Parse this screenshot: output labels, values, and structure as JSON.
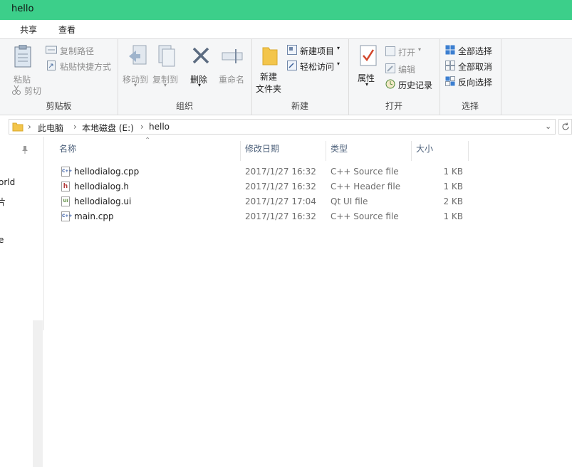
{
  "window": {
    "title": "hello"
  },
  "tabs": [
    {
      "label": "共享"
    },
    {
      "label": "查看"
    }
  ],
  "ribbon": {
    "clipboard": {
      "label": "剪贴板",
      "paste": "粘贴",
      "copy_path": "复制路径",
      "paste_shortcut": "粘贴快捷方式",
      "cut": "剪切"
    },
    "organize": {
      "label": "组织",
      "move_to": "移动到",
      "copy_to": "复制到",
      "delete": "删除",
      "rename": "重命名"
    },
    "new": {
      "label": "新建",
      "new_item": "新建项目",
      "easy_access": "轻松访问",
      "new_folder_line1": "新建",
      "new_folder_line2": "文件夹"
    },
    "open": {
      "label": "打开",
      "properties": "属性",
      "open": "打开",
      "edit": "编辑",
      "history": "历史记录"
    },
    "select": {
      "label": "选择",
      "select_all": "全部选择",
      "select_none": "全部取消",
      "invert": "反向选择"
    }
  },
  "address": {
    "crumbs": [
      {
        "label": "此电脑"
      },
      {
        "label": "本地磁盘 (E:)"
      },
      {
        "label": "hello"
      }
    ]
  },
  "nav": {
    "items": [
      {
        "label": "orld"
      },
      {
        "label": "片"
      },
      {
        "label": "e"
      }
    ]
  },
  "columns": {
    "name": "名称",
    "date": "修改日期",
    "type": "类型",
    "size": "大小"
  },
  "files": [
    {
      "name": "hellodialog.cpp",
      "date": "2017/1/27 16:32",
      "type": "C++ Source file",
      "size": "1 KB",
      "icon": "cpp-file-icon",
      "icon_label": "C++",
      "icon_color": "#3a5fa8"
    },
    {
      "name": "hellodialog.h",
      "date": "2017/1/27 16:32",
      "type": "C++ Header file",
      "size": "1 KB",
      "icon": "header-file-icon",
      "icon_label": "h",
      "icon_color": "#b43c3c"
    },
    {
      "name": "hellodialog.ui",
      "date": "2017/1/27 17:04",
      "type": "Qt UI file",
      "size": "2 KB",
      "icon": "ui-file-icon",
      "icon_label": "UI",
      "icon_color": "#5a8a3a"
    },
    {
      "name": "main.cpp",
      "date": "2017/1/27 16:32",
      "type": "C++ Source file",
      "size": "1 KB",
      "icon": "cpp-file-icon",
      "icon_label": "C++",
      "icon_color": "#3a5fa8"
    }
  ],
  "colors": {
    "titlebar": "#3ccf8a",
    "header_text": "#4c607a"
  }
}
